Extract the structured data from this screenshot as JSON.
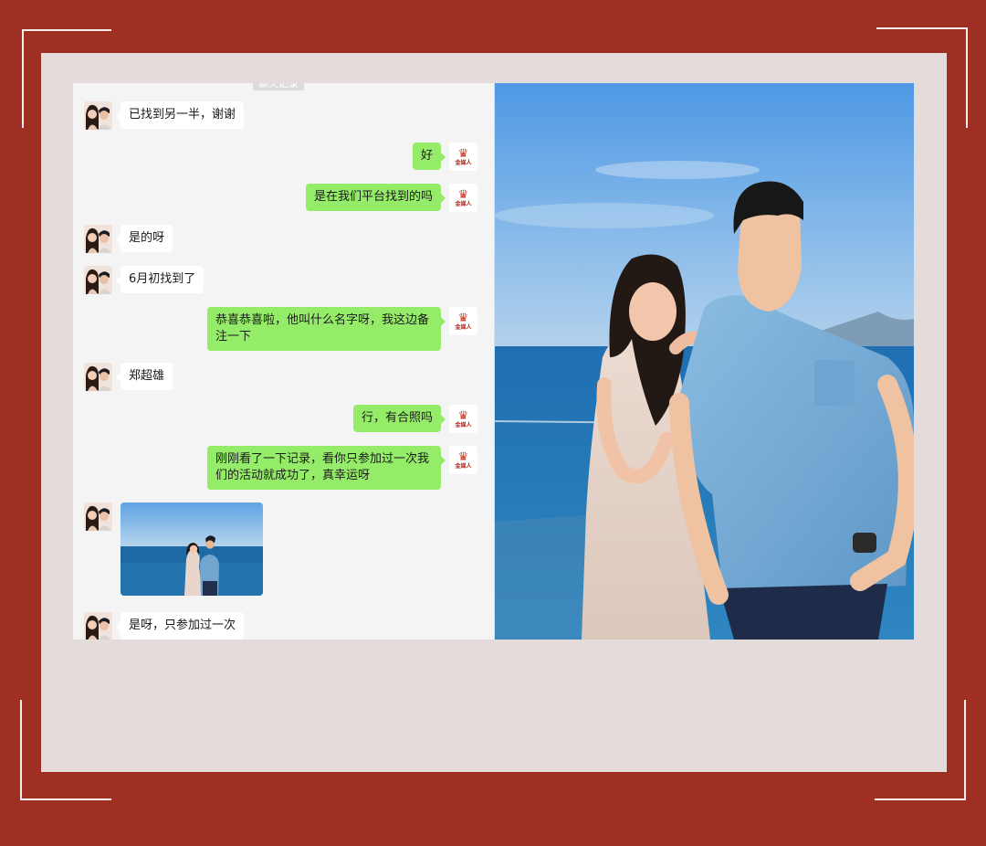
{
  "chat": {
    "top_stamp": "聊天记录",
    "messages": [
      {
        "side": "left",
        "text": "已找到另一半，谢谢"
      },
      {
        "side": "right",
        "text": "好"
      },
      {
        "side": "right",
        "text": "是在我们平台找到的吗"
      },
      {
        "side": "left",
        "text": "是的呀"
      },
      {
        "side": "left",
        "text": "6月初找到了"
      },
      {
        "side": "right",
        "text": "恭喜恭喜啦，他叫什么名字呀，我这边备注一下"
      },
      {
        "side": "left",
        "text": "郑超雄"
      },
      {
        "side": "right",
        "text": "行，有合照吗"
      },
      {
        "side": "right",
        "text": "刚刚看了一下记录，看你只参加过一次我们的活动就成功了，真幸运呀"
      },
      {
        "side": "left",
        "type": "image"
      },
      {
        "side": "left",
        "text": "是呀，只参加过一次"
      }
    ]
  },
  "brand": {
    "mark": "♛",
    "name": "金媒人"
  },
  "colors": {
    "frame": "#9e2f22",
    "mat": "#e3dcdb",
    "sent_bubble": "#95ec69",
    "received_bubble": "#ffffff"
  }
}
